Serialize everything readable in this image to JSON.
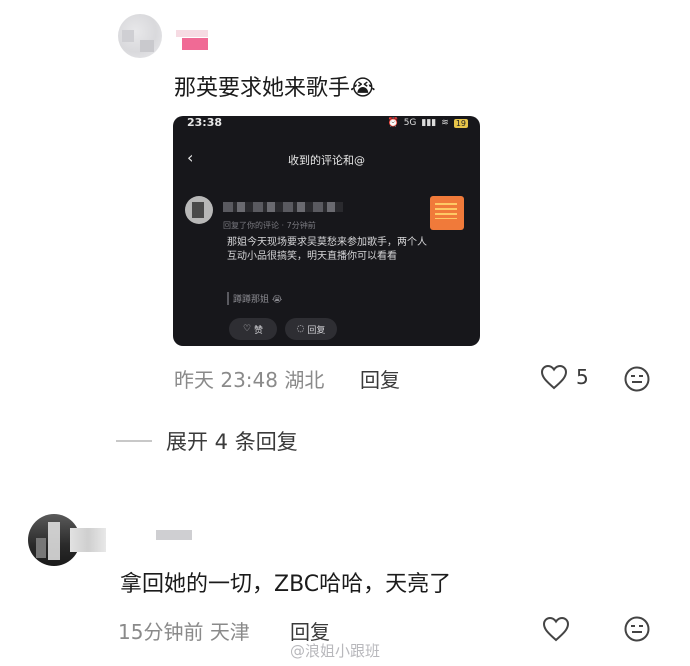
{
  "comments": [
    {
      "text": "那英要求她来歌手",
      "emoji": "😭",
      "time": "昨天 23:48",
      "location": "湖北",
      "reply_label": "回复",
      "likes": "5"
    },
    {
      "text": "拿回她的一切，ZBC哈哈，天亮了",
      "time": "15分钟前",
      "location": "天津",
      "reply_label": "回复"
    }
  ],
  "embedded": {
    "status_time": "23:38",
    "status_right": "5G",
    "battery": "19",
    "title": "收到的评论和@",
    "sub": "回复了你的评论 · 7分钟前",
    "body": "那姐今天现场要求吴莫愁来参加歌手，两个人互动小品很搞笑，明天直播你可以看看",
    "quote": "蹲蹲那姐",
    "quote_emoji": "😭",
    "like_label": "赞",
    "reply_label": "回复"
  },
  "expand": {
    "label": "展开 4 条回复"
  },
  "watermark": "@浪姐小跟班",
  "colors": {
    "accent_pink": "#f06a95",
    "text": "#1b1b1b",
    "meta": "#8a8a8a"
  }
}
